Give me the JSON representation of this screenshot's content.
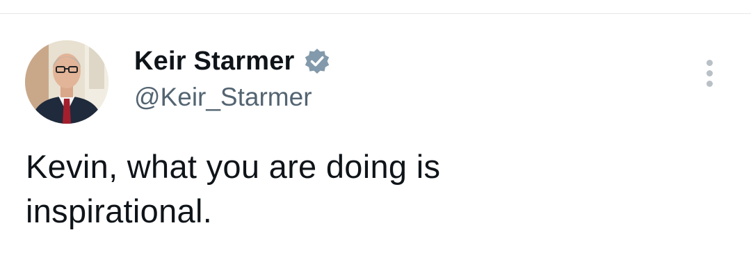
{
  "author": {
    "display_name": "Keir Starmer",
    "handle": "@Keir_Starmer",
    "verified": true,
    "avatar": "profile-photo"
  },
  "tweet": {
    "text": "Kevin, what you are doing is\ninspirational."
  },
  "icons": {
    "verified": "verified-badge-icon",
    "more": "more-options-icon"
  },
  "colors": {
    "verified_badge": "#829aab",
    "handle_text": "#536471",
    "more_dots": "#b9c0c6",
    "text": "#0f1419"
  }
}
